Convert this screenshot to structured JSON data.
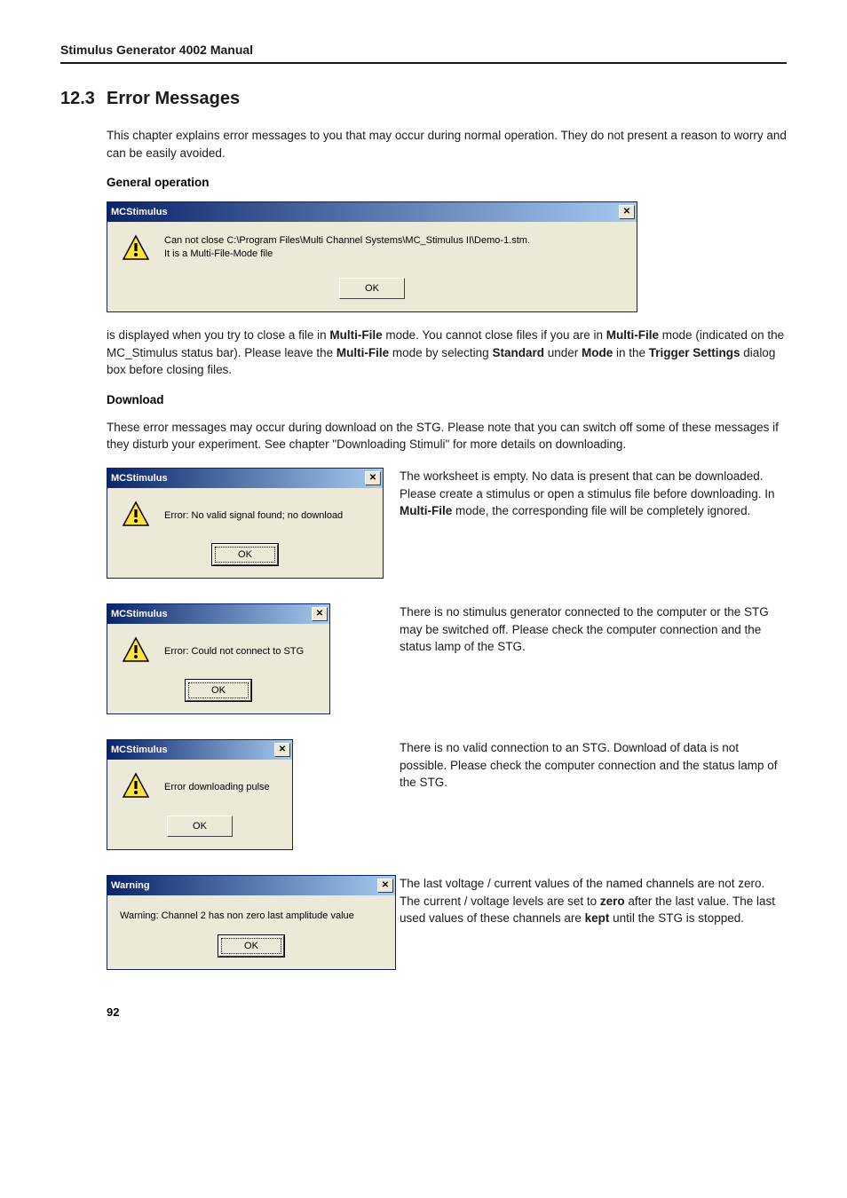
{
  "header": {
    "doc_title": "Stimulus Generator 4002 Manual"
  },
  "section": {
    "number": "12.3",
    "title": "Error Messages"
  },
  "intro": "This chapter explains error messages to you that may occur during normal operation. They do not present a reason to worry and can be easily avoided.",
  "general": {
    "heading": "General operation",
    "dialog": {
      "title": "MCStimulus",
      "line1": "Can not close C:\\Program Files\\Multi Channel Systems\\MC_Stimulus II\\Demo-1.stm.",
      "line2": "It is a Multi-File-Mode file",
      "ok": "OK"
    },
    "explain_pre": "is displayed when you try to close a file in ",
    "explain_b1": "Multi-File",
    "explain_mid1": " mode. You cannot close files if you are in ",
    "explain_b2": "Multi-File",
    "explain_mid2": " mode (indicated on the MC_Stimulus status bar). Please leave the ",
    "explain_b3": "Multi-File",
    "explain_mid3": " mode by selecting ",
    "explain_b4": "Standard",
    "explain_mid4": " under ",
    "explain_b5": "Mode",
    "explain_mid5": " in the ",
    "explain_b6": "Trigger Settings",
    "explain_end": " dialog box before closing files."
  },
  "download": {
    "heading": "Download",
    "intro": "These error messages may occur during download on the STG. Please note that you can switch off some of these messages if they disturb your experiment. See chapter \"Downloading Stimuli\" for more details on downloading.",
    "rows": [
      {
        "dlg_title": "MCStimulus",
        "dlg_text": "Error: No valid signal found; no download",
        "ok": "OK",
        "desc_pre": "The worksheet is empty. No data is present that can be downloaded. Please create a stimulus or open a stimulus file before downloading. In ",
        "desc_b": "Multi-File",
        "desc_post": " mode, the corresponding file will be completely ignored."
      },
      {
        "dlg_title": "MCStimulus",
        "dlg_text": "Error: Could not connect to STG",
        "ok": "OK",
        "desc": "There is no stimulus generator connected to the computer or the STG may be switched off. Please check the computer connection and the status lamp of the STG."
      },
      {
        "dlg_title": "MCStimulus",
        "dlg_text": "Error downloading pulse",
        "ok": "OK",
        "desc": "There is no valid connection to an STG. Download of data is not possible. Please check the computer connection and the status lamp of the STG."
      },
      {
        "dlg_title": "Warning",
        "dlg_text": "Warning: Channel 2 has non zero last amplitude value",
        "ok": "OK",
        "desc_pre": "The last voltage / current values of the named channels are not zero. The current / voltage levels are set to ",
        "desc_b1": "zero",
        "desc_mid": " after the last value. The last used values of these channels are ",
        "desc_b2": "kept",
        "desc_post": " until the STG is stopped."
      }
    ]
  },
  "page_number": "92",
  "icons": {
    "close_x": "✕"
  }
}
